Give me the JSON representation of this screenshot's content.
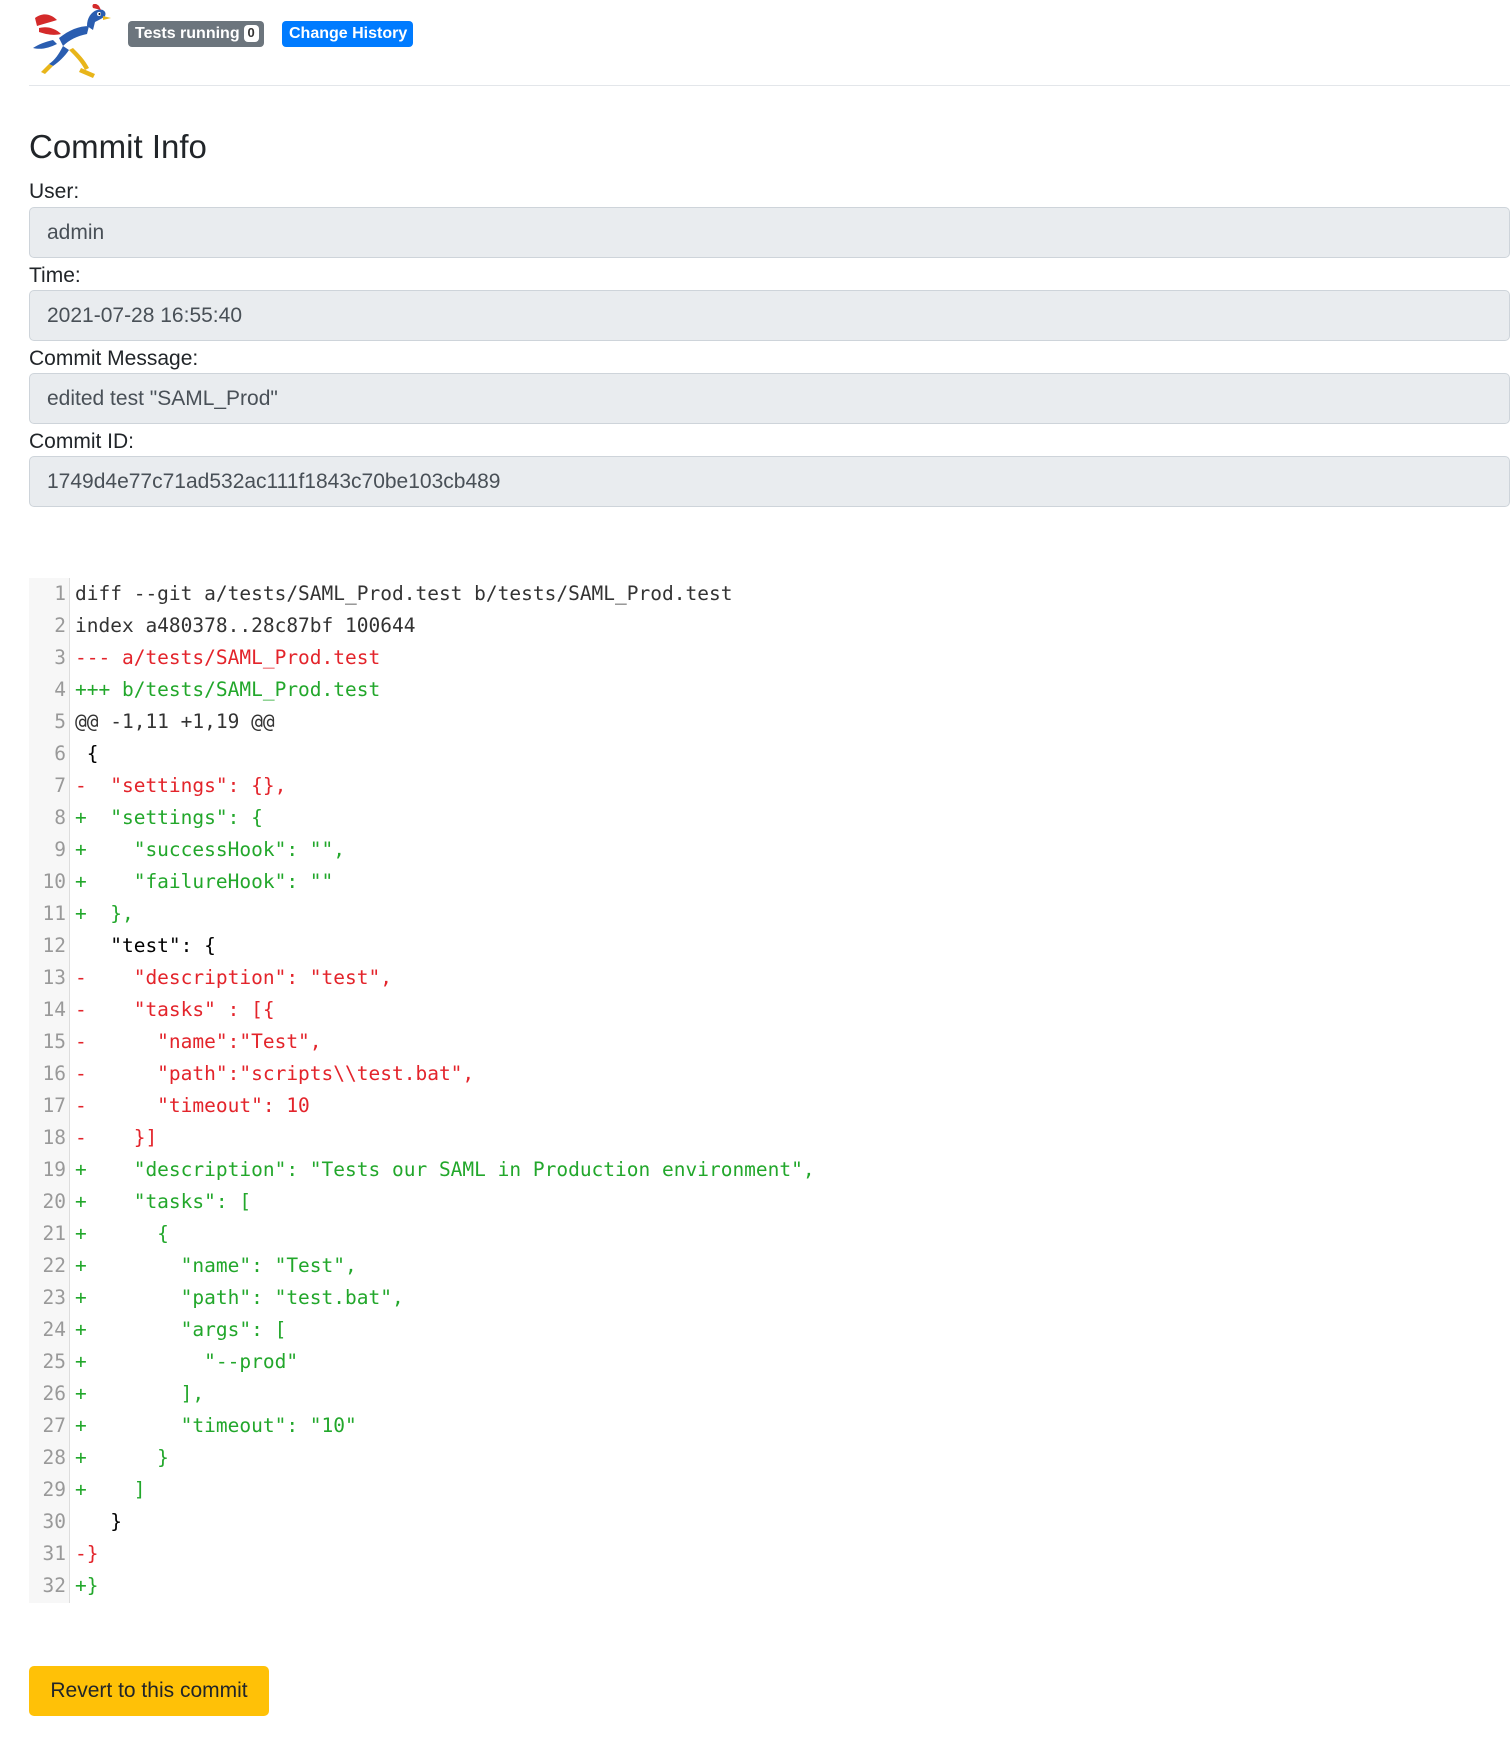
{
  "navbar": {
    "logo": "roadrunner-logo",
    "tests_running_label": "Tests running",
    "tests_running_count": "0",
    "change_history_label": "Change History"
  },
  "commit": {
    "title": "Commit Info",
    "user_label": "User:",
    "user_value": "admin",
    "time_label": "Time:",
    "time_value": "2021-07-28 16:55:40",
    "message_label": "Commit Message:",
    "message_value": "edited test \"SAML_Prod\"",
    "id_label": "Commit ID:",
    "id_value": "1749d4e77c71ad532ac111f1843c70be103cb489"
  },
  "diff": {
    "colors": {
      "deleted": "#e3242b",
      "added": "#22a72b",
      "context": "#000000",
      "gutter_bg": "#f7f7f7"
    },
    "lines": [
      {
        "n": "1",
        "type": "meta",
        "text": "diff --git a/tests/SAML_Prod.test b/tests/SAML_Prod.test"
      },
      {
        "n": "2",
        "type": "meta",
        "text": "index a480378..28c87bf 100644"
      },
      {
        "n": "3",
        "type": "del",
        "text": "--- a/tests/SAML_Prod.test"
      },
      {
        "n": "4",
        "type": "add",
        "text": "+++ b/tests/SAML_Prod.test"
      },
      {
        "n": "5",
        "type": "meta",
        "text": "@@ -1,11 +1,19 @@"
      },
      {
        "n": "6",
        "type": "ctx",
        "text": " {"
      },
      {
        "n": "7",
        "type": "del",
        "text": "-  \"settings\": {},"
      },
      {
        "n": "8",
        "type": "add",
        "text": "+  \"settings\": {"
      },
      {
        "n": "9",
        "type": "add",
        "text": "+    \"successHook\": \"\","
      },
      {
        "n": "10",
        "type": "add",
        "text": "+    \"failureHook\": \"\""
      },
      {
        "n": "11",
        "type": "add",
        "text": "+  },"
      },
      {
        "n": "12",
        "type": "ctx",
        "text": "   \"test\": {"
      },
      {
        "n": "13",
        "type": "del",
        "text": "-    \"description\": \"test\","
      },
      {
        "n": "14",
        "type": "del",
        "text": "-    \"tasks\" : [{"
      },
      {
        "n": "15",
        "type": "del",
        "text": "-      \"name\":\"Test\","
      },
      {
        "n": "16",
        "type": "del",
        "text": "-      \"path\":\"scripts\\\\test.bat\","
      },
      {
        "n": "17",
        "type": "del",
        "text": "-      \"timeout\": 10"
      },
      {
        "n": "18",
        "type": "del",
        "text": "-    }]"
      },
      {
        "n": "19",
        "type": "add",
        "text": "+    \"description\": \"Tests our SAML in Production environment\","
      },
      {
        "n": "20",
        "type": "add",
        "text": "+    \"tasks\": ["
      },
      {
        "n": "21",
        "type": "add",
        "text": "+      {"
      },
      {
        "n": "22",
        "type": "add",
        "text": "+        \"name\": \"Test\","
      },
      {
        "n": "23",
        "type": "add",
        "text": "+        \"path\": \"test.bat\","
      },
      {
        "n": "24",
        "type": "add",
        "text": "+        \"args\": ["
      },
      {
        "n": "25",
        "type": "add",
        "text": "+          \"--prod\""
      },
      {
        "n": "26",
        "type": "add",
        "text": "+        ],"
      },
      {
        "n": "27",
        "type": "add",
        "text": "+        \"timeout\": \"10\""
      },
      {
        "n": "28",
        "type": "add",
        "text": "+      }"
      },
      {
        "n": "29",
        "type": "add",
        "text": "+    ]"
      },
      {
        "n": "30",
        "type": "ctx",
        "text": "   }"
      },
      {
        "n": "31",
        "type": "del",
        "text": "-}"
      },
      {
        "n": "32",
        "type": "add",
        "text": "+}"
      }
    ]
  },
  "actions": {
    "revert_label": "Revert to this commit"
  }
}
